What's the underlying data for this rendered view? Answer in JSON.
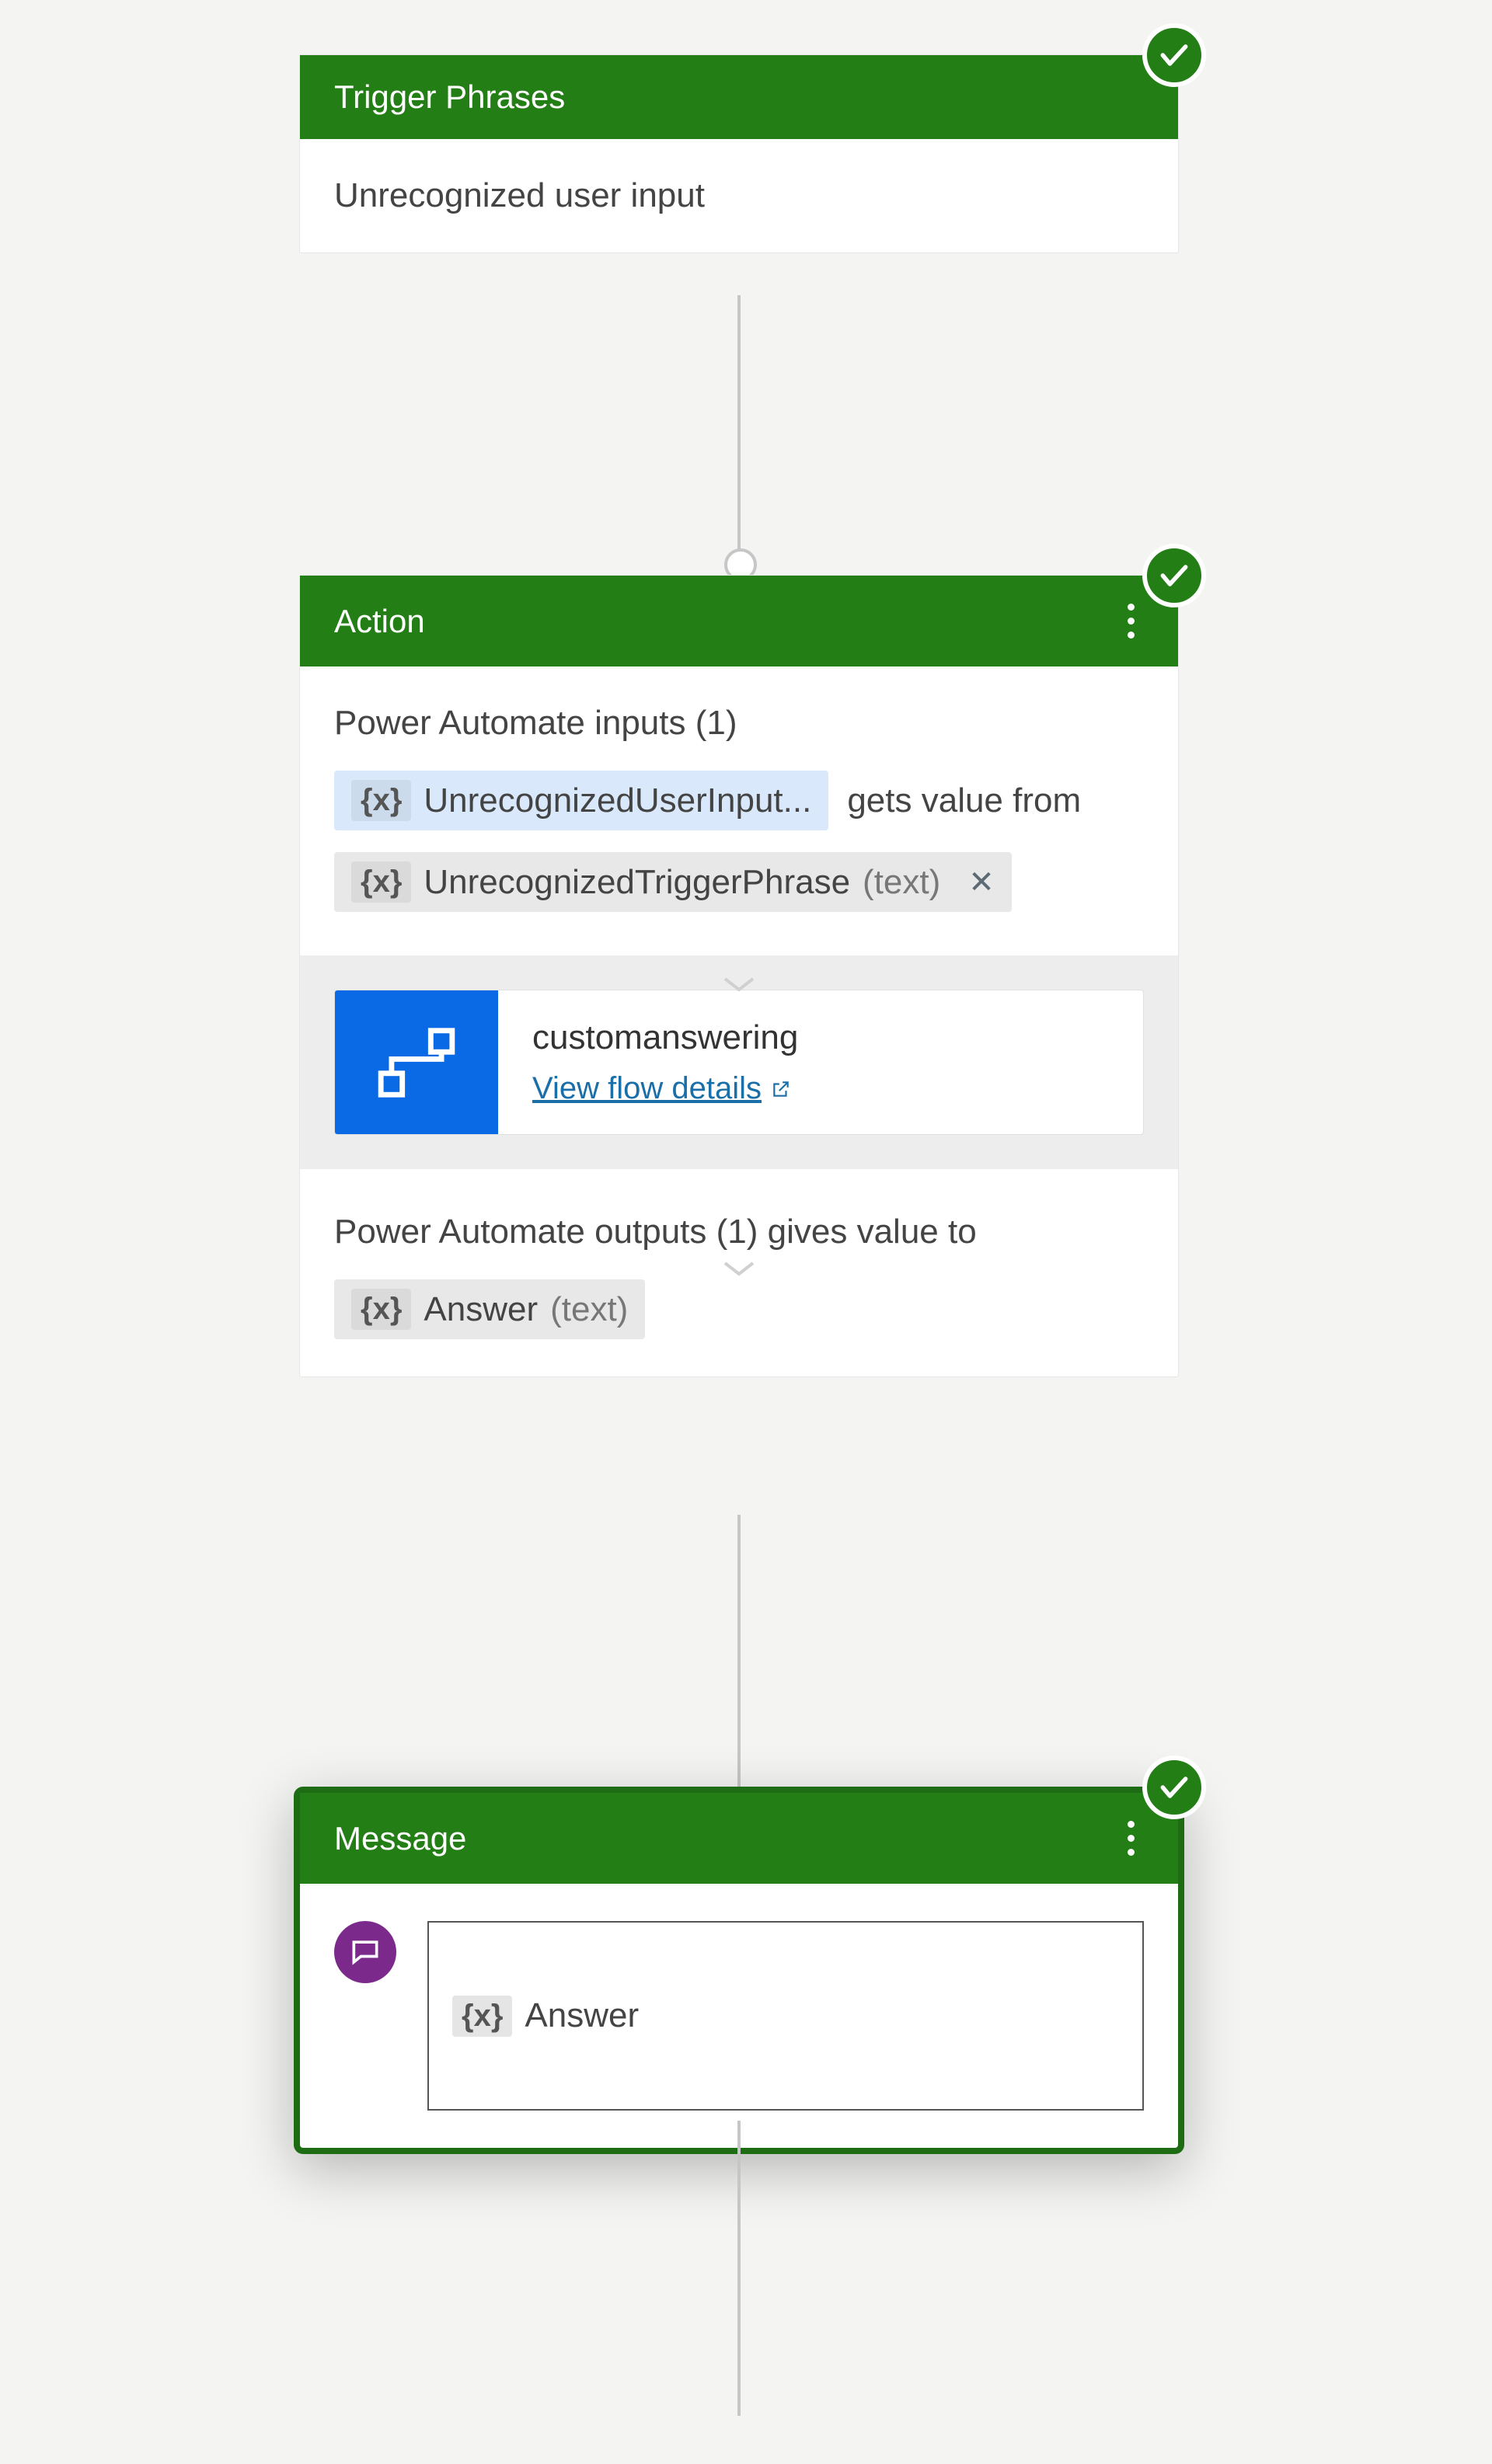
{
  "trigger": {
    "header": "Trigger Phrases",
    "phrase": "Unrecognized user input"
  },
  "action": {
    "header": "Action",
    "inputs_label": "Power Automate inputs (1)",
    "input_var": "UnrecognizedUserInput...",
    "gets": "gets value from",
    "source_var": "UnrecognizedTriggerPhrase",
    "source_type": "(text)",
    "flow_name": "customanswering",
    "flow_link": "View flow details",
    "outputs_label": "Power Automate outputs (1) gives value to",
    "output_var": "Answer",
    "output_type": "(text)"
  },
  "message": {
    "header": "Message",
    "var": "Answer"
  },
  "glyphs": {
    "vx": "{x}",
    "close": "✕",
    "open": "↗"
  }
}
